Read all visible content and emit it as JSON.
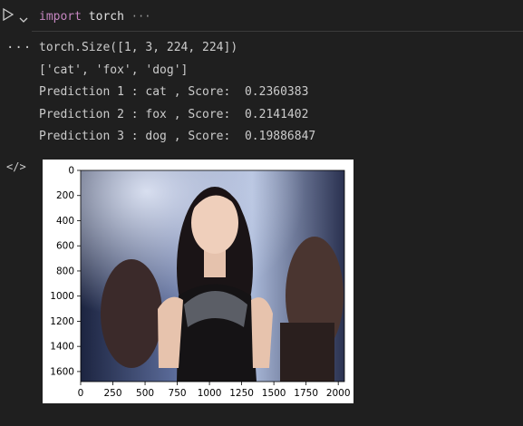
{
  "cell": {
    "code_keyword": "import",
    "code_module": "torch",
    "more_icon": "ellipsis-icon",
    "run_icon": "play-icon",
    "expand_icon": "chevron-down-icon"
  },
  "output": {
    "ellipsis_label": "...",
    "lines": [
      "torch.Size([1, 3, 224, 224])",
      "['cat', 'fox', 'dog']",
      "Prediction 1 : cat , Score:  0.2360383",
      "Prediction 2 : fox , Score:  0.2141402",
      "Prediction 3 : dog , Score:  0.19886847"
    ],
    "code_tag_icon": "</>"
  },
  "chart_data": {
    "type": "image",
    "y_ticks": [
      "0",
      "200",
      "400",
      "600",
      "800",
      "1000",
      "1200",
      "1400",
      "1600"
    ],
    "x_ticks": [
      "0",
      "250",
      "500",
      "750",
      "1000",
      "1250",
      "1500",
      "1750",
      "2000"
    ],
    "xlim": [
      0,
      2048
    ],
    "ylim": [
      1680,
      0
    ]
  }
}
